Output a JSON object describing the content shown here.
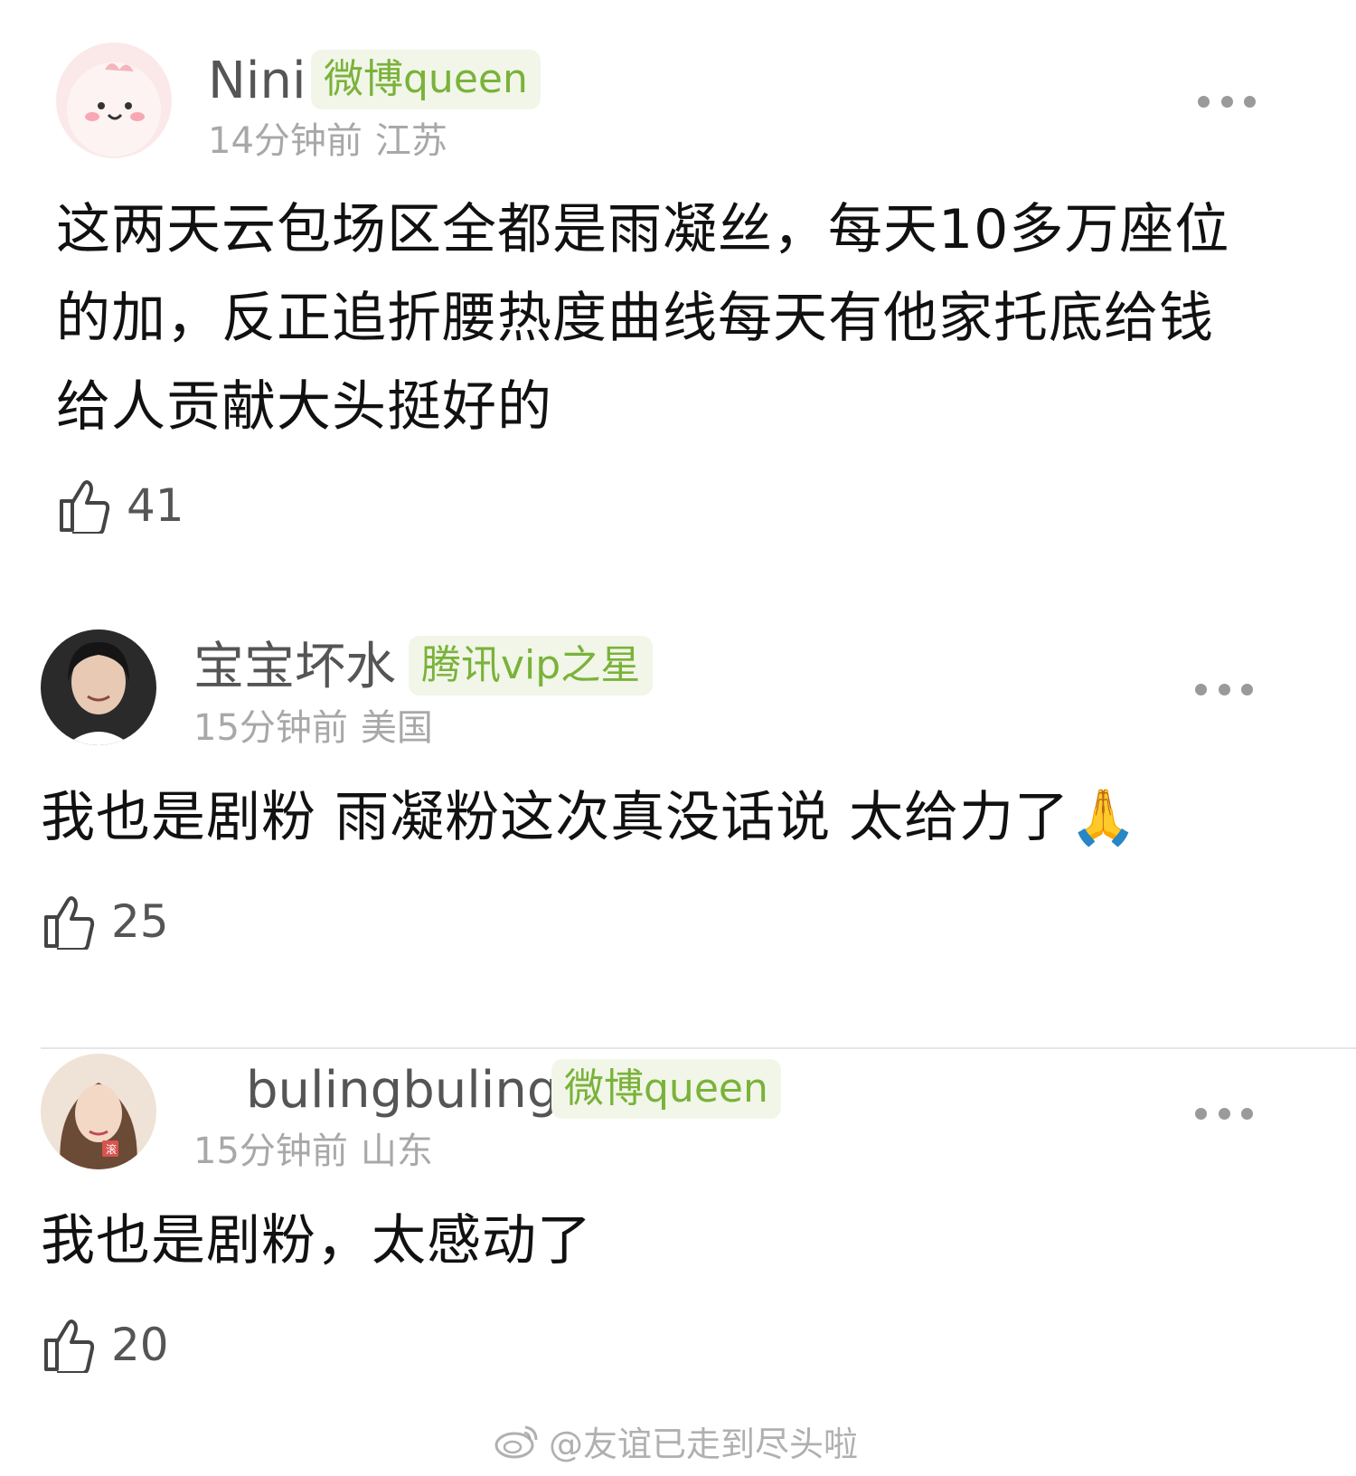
{
  "comments": [
    {
      "username": "Nini",
      "badge": "微博queen",
      "time": "14分钟前",
      "location": "江苏",
      "text": "这两天云包场区全都是雨凝丝，每天10多万座位的加，反正追折腰热度曲线每天有他家托底给钱给人贡献大头挺好的",
      "likes": "41"
    },
    {
      "username": "宝宝坏水",
      "badge": "腾讯vip之星",
      "time": "15分钟前",
      "location": "美国",
      "text": "我也是剧粉 雨凝粉这次真没话说 太给力了",
      "emoji": "🙏",
      "likes": "25"
    },
    {
      "username": "bulingbuling",
      "badge": "微博queen",
      "time": "15分钟前",
      "location": "山东",
      "text": "我也是剧粉，太感动了",
      "likes": "20",
      "avatar_tag": "滚"
    }
  ],
  "watermark": "@友谊已走到尽头啦",
  "colors": {
    "badge_text": "#7ab23a",
    "badge_bg": "#f1f6e8",
    "meta_text": "#a8a8a8",
    "body_text": "#111111"
  },
  "icons": {
    "like": "thumbs-up-icon",
    "more": "more-dots-icon",
    "watermark": "weibo-logo-icon"
  }
}
